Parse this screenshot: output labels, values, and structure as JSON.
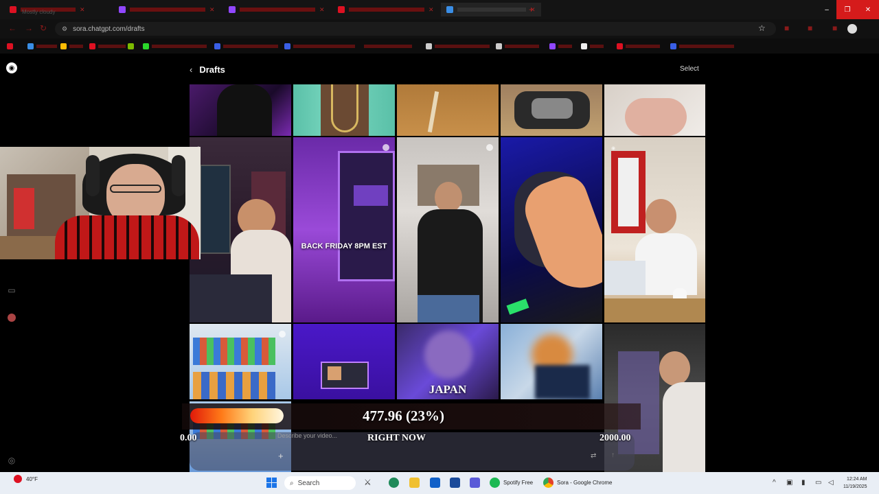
{
  "browser": {
    "url": "sora.chatgpt.com/drafts",
    "tabs": [
      {
        "label": "",
        "color": "#d12"
      },
      {
        "label": "",
        "color": "#d12"
      },
      {
        "label": "",
        "color": "#9147ff"
      },
      {
        "label": "",
        "color": "#9147ff"
      },
      {
        "label": "",
        "color": "#d12"
      },
      {
        "label": "",
        "color": "#3a8ee6"
      }
    ],
    "window_controls": [
      "–",
      "❐",
      "✕"
    ]
  },
  "page": {
    "header": {
      "back_icon": "chevron-left-icon",
      "title": "Drafts",
      "select_label": "Select"
    },
    "sidebar": {
      "logo_icon": "sora-logo-icon",
      "items": [
        "chat-icon",
        "avatar-icon"
      ]
    },
    "tiles": {
      "captions": {
        "back_friday": "BACK FRIDAY 8PM EST",
        "japan": "JAPAN"
      }
    },
    "composer": {
      "placeholder": "Describe your video...",
      "add_icon": "plus-icon",
      "settings_icon": "sliders-icon",
      "send_icon": "arrow-up-icon"
    }
  },
  "goal_overlay": {
    "amount_text": "477.96 (23%)",
    "min_label": "0.00",
    "max_label": "2000.00",
    "label": "RIGHT NOW",
    "progress": 0.239,
    "colors": [
      "#e01a0a",
      "#ff7a18",
      "#ffd37a"
    ]
  },
  "taskbar": {
    "weather": {
      "temp": "40°F",
      "condition": "Mostly cloudy"
    },
    "search_label": "Search",
    "apps": [
      {
        "label": "Spotify Free",
        "color": "#1db954"
      },
      {
        "label": "Sora - Google Chrome",
        "color": "#e3412c"
      }
    ],
    "clock": {
      "time": "12:24 AM",
      "date": "11/19/2025"
    }
  }
}
